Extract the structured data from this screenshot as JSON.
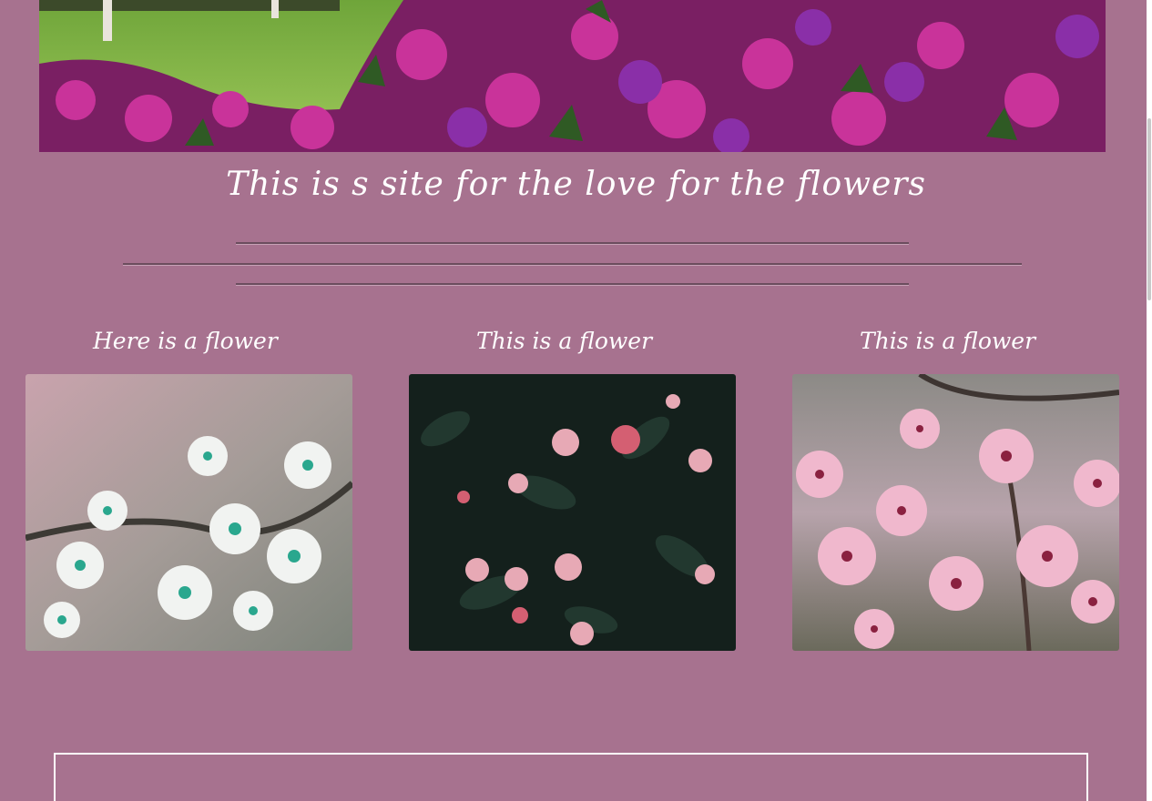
{
  "header": {
    "hero_image_icon": "azalea-garden-image"
  },
  "site_title": "This is s site for the love for the flowers",
  "cards": [
    {
      "title": "Here is a flower",
      "image_icon": "white-teal-blossom-image"
    },
    {
      "title": "This is a flower",
      "image_icon": "dark-camellia-image"
    },
    {
      "title": "This is a flower",
      "image_icon": "pink-cherry-blossom-image"
    }
  ],
  "colors": {
    "background": "#a7728f",
    "title_text": "#ffffff",
    "divider": "#6b4d5e",
    "bottom_box_border": "#ffffff"
  }
}
